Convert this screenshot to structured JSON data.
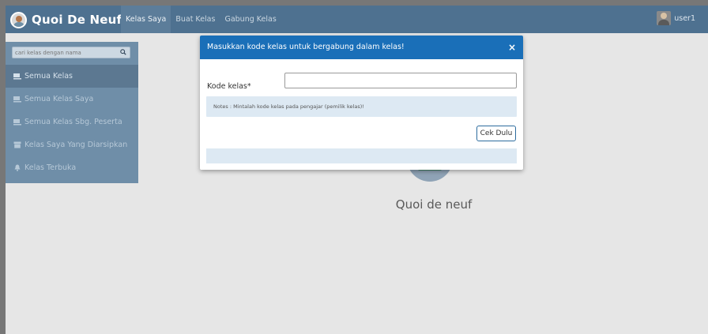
{
  "navbar": {
    "brand": "Quoi De Neuf",
    "links": [
      "Kelas Saya",
      "Buat Kelas",
      "Gabung Kelas"
    ],
    "active_link": "Kelas Saya",
    "user": "user1"
  },
  "sidebar": {
    "search_placeholder": "cari kelas dengan nama",
    "items": [
      {
        "label": "Semua Kelas",
        "icon": "class-icon",
        "active": true
      },
      {
        "label": "Semua Kelas Saya",
        "icon": "class-icon",
        "active": false
      },
      {
        "label": "Semua Kelas Sbg. Peserta",
        "icon": "class-icon",
        "active": false
      },
      {
        "label": "Kelas Saya Yang Diarsipkan",
        "icon": "archive-icon",
        "active": false
      },
      {
        "label": "Kelas Terbuka",
        "icon": "bell-icon",
        "active": false
      }
    ]
  },
  "main": {
    "title": "Quoi de neuf"
  },
  "modal": {
    "title": "Masukkan kode kelas untuk bergabung dalam kelas!",
    "close_label": "×",
    "field_label": "Kode kelas*",
    "field_value": "",
    "notes": "Notes : Mintalah kode kelas pada pengajar (pemilik kelas)!",
    "button_label": "Cek Dulu"
  },
  "colors": {
    "navbar": "#4e7190",
    "sidebar": "#6f8ea8",
    "modal_header": "#1a6fb8",
    "notes_bg": "#dde9f3"
  }
}
